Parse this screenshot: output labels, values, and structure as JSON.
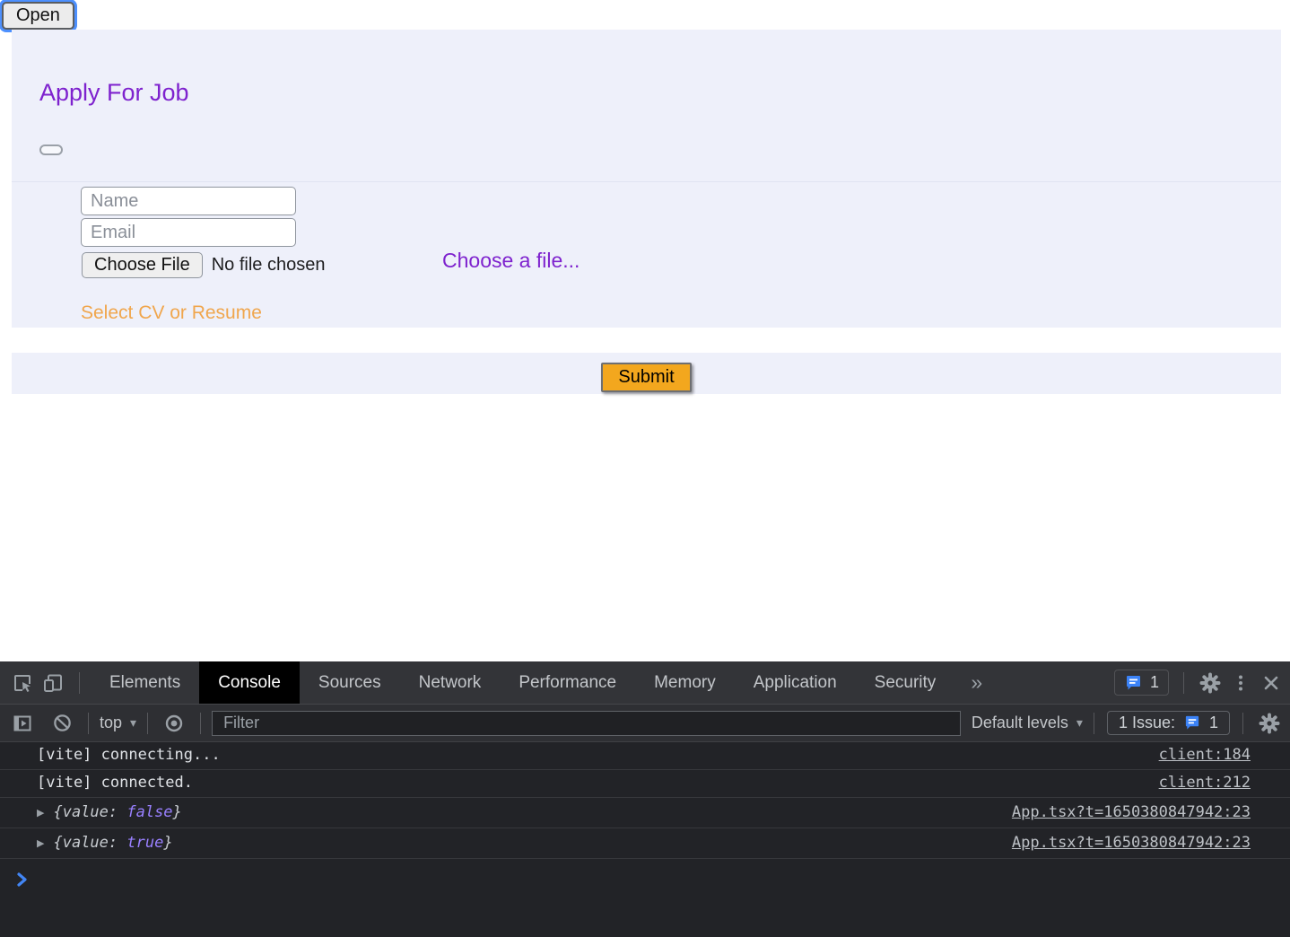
{
  "colors": {
    "accent_purple": "#7e22ce",
    "label_orange": "#f0a64d",
    "submit_orange": "#f3a71e",
    "devtools_blue": "#4285f4",
    "console_bool_purple": "#9980ff",
    "focus_ring_blue": "#4d90fe"
  },
  "icons": {
    "more_tabs": "»",
    "caret_down": "▾",
    "expand_arrow": "▶"
  },
  "page": {
    "open_button_label": "Open",
    "modal": {
      "title": "Apply For Job",
      "name_placeholder": "Name",
      "email_placeholder": "Email",
      "choose_file_button_label": "Choose File",
      "file_status_text": "No file chosen",
      "choose_file_link": "Choose a file...",
      "cv_label": "Select CV or Resume",
      "submit_label": "Submit"
    }
  },
  "devtools": {
    "tabs": [
      "Elements",
      "Console",
      "Sources",
      "Network",
      "Performance",
      "Memory",
      "Application",
      "Security"
    ],
    "active_tab": "Console",
    "tabbar_issues_count": "1",
    "toolbar": {
      "context_selector": "top",
      "filter_placeholder": "Filter",
      "levels_selector": "Default levels",
      "issues_label": "1 Issue:",
      "issues_count": "1"
    },
    "console_messages": [
      {
        "text": "[vite] connecting...",
        "source": "client:184"
      },
      {
        "text": "[vite] connected.",
        "source": "client:212"
      },
      {
        "prefix": "{value: ",
        "value": "false",
        "suffix": "}",
        "source": "App.tsx?t=1650380847942:23"
      },
      {
        "prefix": "{value: ",
        "value": "true",
        "suffix": "}",
        "source": "App.tsx?t=1650380847942:23"
      }
    ]
  }
}
